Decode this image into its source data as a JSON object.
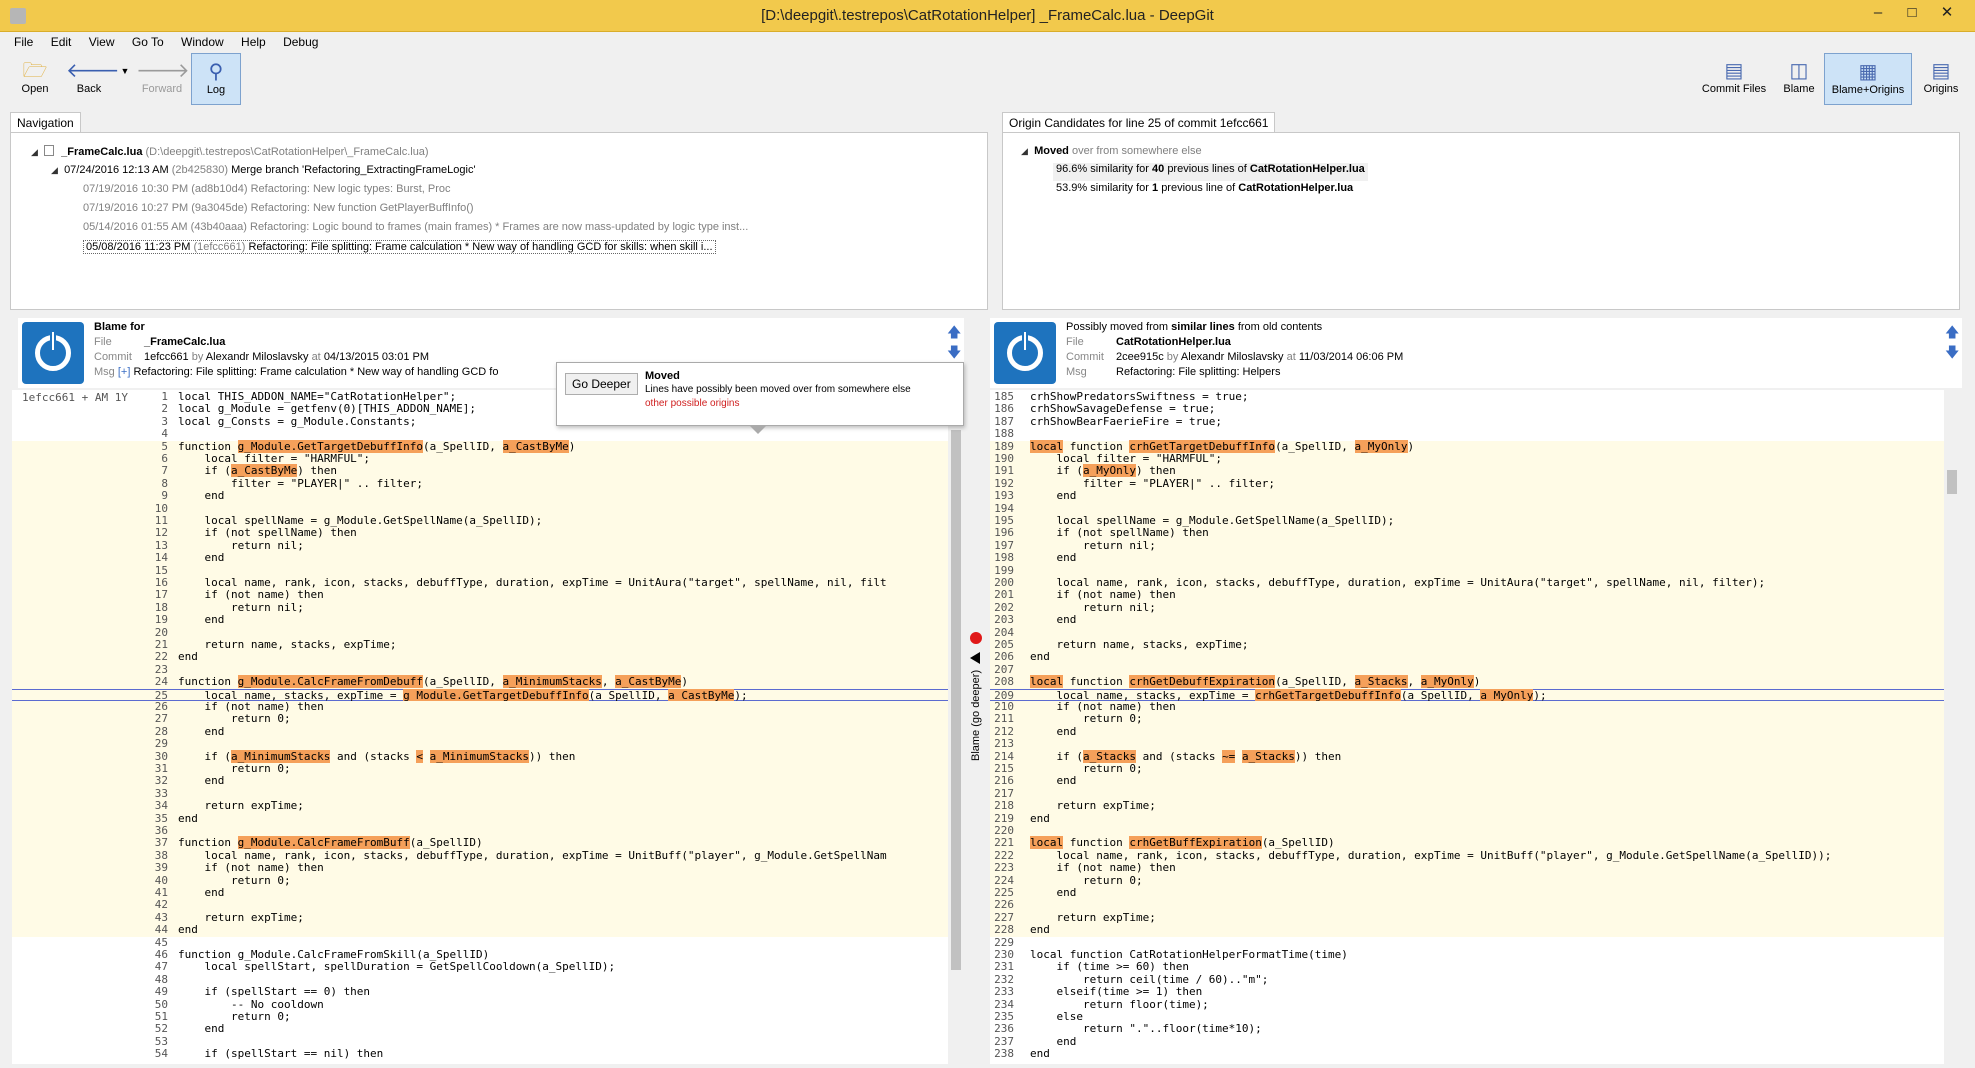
{
  "window": {
    "title": "[D:\\deepgit\\.testrepos\\CatRotationHelper] _FrameCalc.lua - DeepGit",
    "minimize": "–",
    "maximize": "□",
    "close": "✕"
  },
  "menu": [
    "File",
    "Edit",
    "View",
    "Go To",
    "Window",
    "Help",
    "Debug"
  ],
  "toolbar": {
    "open": "Open",
    "back": "Back",
    "forward": "Forward",
    "log": "Log",
    "commit_files": "Commit Files",
    "blame": "Blame",
    "blame_origins": "Blame+Origins",
    "origins": "Origins"
  },
  "navigation": {
    "tab": "Navigation",
    "root_file": "_FrameCalc.lua",
    "root_path": "(D:\\deepgit\\.testrepos\\CatRotationHelper\\_FrameCalc.lua)",
    "rows": [
      {
        "date": "07/24/2016 12:13 AM",
        "hash": "(2b425830)",
        "msg": "Merge branch 'Refactoring_ExtractingFrameLogic'"
      },
      {
        "date": "07/19/2016 10:30 PM",
        "hash": "(ad8b10d4)",
        "msg": "Refactoring: New logic types: Burst, Proc"
      },
      {
        "date": "07/19/2016 10:27 PM",
        "hash": "(9a3045de)",
        "msg": "Refactoring: New function GetPlayerBuffInfo()"
      },
      {
        "date": "05/14/2016 01:55 AM",
        "hash": "(43b40aaa)",
        "msg": "Refactoring: Logic bound to frames (main frames) * Frames are now mass-updated by logic type inst..."
      },
      {
        "date": "05/08/2016 11:23 PM",
        "hash": "(1efcc661)",
        "msg": "Refactoring: File splitting: Frame calculation * New way of handling GCD for skills: when skill i..."
      }
    ]
  },
  "origins_panel": {
    "tab": "Origin Candidates for line 25 of commit 1efcc661",
    "moved_label": "Moved",
    "moved_rest": "over from somewhere else",
    "candidates": [
      {
        "pct": "96.6%",
        "text_a": "similarity for",
        "count": "40",
        "text_b": "previous lines of",
        "file": "CatRotationHelper.lua"
      },
      {
        "pct": "53.9%",
        "text_a": "similarity for",
        "count": "1",
        "text_b": "previous line of",
        "file": "CatRotationHelper.lua"
      }
    ]
  },
  "left_header": {
    "title": "Blame for",
    "file_key": "File",
    "file": "_FrameCalc.lua",
    "commit_key": "Commit",
    "commit_hash": "1efcc661",
    "commit_by": "by",
    "author": "Alexandr Miloslavsky",
    "commit_at": "at",
    "date": "04/13/2015 03:01 PM",
    "msg_key": "Msg",
    "msg_plus": "[+]",
    "msg": "Refactoring: File splitting: Frame calculation * New way of handling GCD fo"
  },
  "right_header": {
    "title_a": "Possibly moved from",
    "title_b": "similar lines",
    "title_c": "from old contents",
    "file_key": "File",
    "file": "CatRotationHelper.lua",
    "commit_key": "Commit",
    "commit_hash": "2cee915c",
    "commit_by": "by",
    "author": "Alexandr Miloslavsky",
    "commit_at": "at",
    "date": "11/03/2014 06:06 PM",
    "msg_key": "Msg",
    "msg": "Refactoring: File splitting: Helpers"
  },
  "popup": {
    "button": "Go Deeper",
    "title": "Moved",
    "text": "Lines have possibly been moved over from somewhere else",
    "link": "other possible origins"
  },
  "splitter_label": "Blame (go deeper)",
  "left_gutter": "1efcc661  +  AM  1Y",
  "left_code": [
    {
      "n": "1",
      "t": "local THIS_ADDON_NAME=\"CatRotationHelper\";"
    },
    {
      "n": "2",
      "t": "local g_Module = getfenv(0)[THIS_ADDON_NAME];"
    },
    {
      "n": "3",
      "t": "local g_Consts = g_Module.Constants;"
    },
    {
      "n": "4",
      "t": ""
    },
    {
      "n": "5",
      "t": "function g_Module.GetTargetDebuffInfo(a_SpellID, a_CastByMe)"
    },
    {
      "n": "6",
      "t": "    local filter = \"HARMFUL\";"
    },
    {
      "n": "7",
      "t": "    if (a_CastByMe) then"
    },
    {
      "n": "8",
      "t": "        filter = \"PLAYER|\" .. filter;"
    },
    {
      "n": "9",
      "t": "    end"
    },
    {
      "n": "10",
      "t": ""
    },
    {
      "n": "11",
      "t": "    local spellName = g_Module.GetSpellName(a_SpellID);"
    },
    {
      "n": "12",
      "t": "    if (not spellName) then"
    },
    {
      "n": "13",
      "t": "        return nil;"
    },
    {
      "n": "14",
      "t": "    end"
    },
    {
      "n": "15",
      "t": ""
    },
    {
      "n": "16",
      "t": "    local name, rank, icon, stacks, debuffType, duration, expTime = UnitAura(\"target\", spellName, nil, filt"
    },
    {
      "n": "17",
      "t": "    if (not name) then"
    },
    {
      "n": "18",
      "t": "        return nil;"
    },
    {
      "n": "19",
      "t": "    end"
    },
    {
      "n": "20",
      "t": ""
    },
    {
      "n": "21",
      "t": "    return name, stacks, expTime;"
    },
    {
      "n": "22",
      "t": "end"
    },
    {
      "n": "23",
      "t": ""
    },
    {
      "n": "24",
      "t": "function g_Module.CalcFrameFromDebuff(a_SpellID, a_MinimumStacks, a_CastByMe)"
    },
    {
      "n": "25",
      "t": "    local name, stacks, expTime = g_Module.GetTargetDebuffInfo(a_SpellID, a_CastByMe);"
    },
    {
      "n": "26",
      "t": "    if (not name) then"
    },
    {
      "n": "27",
      "t": "        return 0;"
    },
    {
      "n": "28",
      "t": "    end"
    },
    {
      "n": "29",
      "t": ""
    },
    {
      "n": "30",
      "t": "    if (a_MinimumStacks and (stacks < a_MinimumStacks)) then"
    },
    {
      "n": "31",
      "t": "        return 0;"
    },
    {
      "n": "32",
      "t": "    end"
    },
    {
      "n": "33",
      "t": ""
    },
    {
      "n": "34",
      "t": "    return expTime;"
    },
    {
      "n": "35",
      "t": "end"
    },
    {
      "n": "36",
      "t": ""
    },
    {
      "n": "37",
      "t": "function g_Module.CalcFrameFromBuff(a_SpellID)"
    },
    {
      "n": "38",
      "t": "    local name, rank, icon, stacks, debuffType, duration, expTime = UnitBuff(\"player\", g_Module.GetSpellNam"
    },
    {
      "n": "39",
      "t": "    if (not name) then"
    },
    {
      "n": "40",
      "t": "        return 0;"
    },
    {
      "n": "41",
      "t": "    end"
    },
    {
      "n": "42",
      "t": ""
    },
    {
      "n": "43",
      "t": "    return expTime;"
    },
    {
      "n": "44",
      "t": "end"
    },
    {
      "n": "45",
      "t": ""
    },
    {
      "n": "46",
      "t": "function g_Module.CalcFrameFromSkill(a_SpellID)"
    },
    {
      "n": "47",
      "t": "    local spellStart, spellDuration = GetSpellCooldown(a_SpellID);"
    },
    {
      "n": "48",
      "t": ""
    },
    {
      "n": "49",
      "t": "    if (spellStart == 0) then"
    },
    {
      "n": "50",
      "t": "        -- No cooldown"
    },
    {
      "n": "51",
      "t": "        return 0;"
    },
    {
      "n": "52",
      "t": "    end"
    },
    {
      "n": "53",
      "t": ""
    },
    {
      "n": "54",
      "t": "    if (spellStart == nil) then"
    }
  ],
  "right_code": [
    {
      "n": "185",
      "t": "crhShowPredatorsSwiftness = true;"
    },
    {
      "n": "186",
      "t": "crhShowSavageDefense = true;"
    },
    {
      "n": "187",
      "t": "crhShowBearFaerieFire = true;"
    },
    {
      "n": "188",
      "t": ""
    },
    {
      "n": "189",
      "t": "local function crhGetTargetDebuffInfo(a_SpellID, a_MyOnly)"
    },
    {
      "n": "190",
      "t": "    local filter = \"HARMFUL\";"
    },
    {
      "n": "191",
      "t": "    if (a_MyOnly) then"
    },
    {
      "n": "192",
      "t": "        filter = \"PLAYER|\" .. filter;"
    },
    {
      "n": "193",
      "t": "    end"
    },
    {
      "n": "194",
      "t": ""
    },
    {
      "n": "195",
      "t": "    local spellName = g_Module.GetSpellName(a_SpellID);"
    },
    {
      "n": "196",
      "t": "    if (not spellName) then"
    },
    {
      "n": "197",
      "t": "        return nil;"
    },
    {
      "n": "198",
      "t": "    end"
    },
    {
      "n": "199",
      "t": ""
    },
    {
      "n": "200",
      "t": "    local name, rank, icon, stacks, debuffType, duration, expTime = UnitAura(\"target\", spellName, nil, filter);"
    },
    {
      "n": "201",
      "t": "    if (not name) then"
    },
    {
      "n": "202",
      "t": "        return nil;"
    },
    {
      "n": "203",
      "t": "    end"
    },
    {
      "n": "204",
      "t": ""
    },
    {
      "n": "205",
      "t": "    return name, stacks, expTime;"
    },
    {
      "n": "206",
      "t": "end"
    },
    {
      "n": "207",
      "t": ""
    },
    {
      "n": "208",
      "t": "local function crhGetDebuffExpiration(a_SpellID, a_Stacks, a_MyOnly)"
    },
    {
      "n": "209",
      "t": "    local name, stacks, expTime = crhGetTargetDebuffInfo(a_SpellID, a_MyOnly);"
    },
    {
      "n": "210",
      "t": "    if (not name) then"
    },
    {
      "n": "211",
      "t": "        return 0;"
    },
    {
      "n": "212",
      "t": "    end"
    },
    {
      "n": "213",
      "t": ""
    },
    {
      "n": "214",
      "t": "    if (a_Stacks and (stacks ~= a_Stacks)) then"
    },
    {
      "n": "215",
      "t": "        return 0;"
    },
    {
      "n": "216",
      "t": "    end"
    },
    {
      "n": "217",
      "t": ""
    },
    {
      "n": "218",
      "t": "    return expTime;"
    },
    {
      "n": "219",
      "t": "end"
    },
    {
      "n": "220",
      "t": ""
    },
    {
      "n": "221",
      "t": "local function crhGetBuffExpiration(a_SpellID)"
    },
    {
      "n": "222",
      "t": "    local name, rank, icon, stacks, debuffType, duration, expTime = UnitBuff(\"player\", g_Module.GetSpellName(a_SpellID));"
    },
    {
      "n": "223",
      "t": "    if (not name) then"
    },
    {
      "n": "224",
      "t": "        return 0;"
    },
    {
      "n": "225",
      "t": "    end"
    },
    {
      "n": "226",
      "t": ""
    },
    {
      "n": "227",
      "t": "    return expTime;"
    },
    {
      "n": "228",
      "t": "end"
    },
    {
      "n": "229",
      "t": ""
    },
    {
      "n": "230",
      "t": "local function CatRotationHelperFormatTime(time)"
    },
    {
      "n": "231",
      "t": "    if (time >= 60) then"
    },
    {
      "n": "232",
      "t": "        return ceil(time / 60)..\"m\";"
    },
    {
      "n": "233",
      "t": "    elseif(time >= 1) then"
    },
    {
      "n": "234",
      "t": "        return floor(time);"
    },
    {
      "n": "235",
      "t": "    else"
    },
    {
      "n": "236",
      "t": "        return \".\"..floor(time*10);"
    },
    {
      "n": "237",
      "t": "    end"
    },
    {
      "n": "238",
      "t": "end"
    }
  ],
  "left_highlights": {
    "5": [
      "g_Module.GetTargetDebuffInfo",
      "a_CastByMe"
    ],
    "7": [
      "a_CastByMe"
    ],
    "24": [
      "g_Module.CalcFrameFromDebuff",
      "a_MinimumStacks",
      "a_CastByMe"
    ],
    "25": [
      "g_Module.GetTargetDebuffInfo",
      "a_CastByMe"
    ],
    "30": [
      "a_MinimumStacks",
      "<",
      "a_MinimumStacks"
    ],
    "37": [
      "g_Module.CalcFrameFromBuff"
    ]
  },
  "right_highlights": {
    "189": [
      "local",
      "crhGetTargetDebuffInfo",
      "a_MyOnly"
    ],
    "191": [
      "a_MyOnly"
    ],
    "208": [
      "local",
      "crhGetDebuffExpiration",
      "a_Stacks",
      "a_MyOnly"
    ],
    "209": [
      "crhGetTargetDebuffInfo",
      "a_MyOnly"
    ],
    "214": [
      "a_Stacks",
      "~=",
      "a_Stacks"
    ],
    "221": [
      "local",
      "crhGetBuffExpiration"
    ]
  },
  "current_line_left": "25",
  "current_line_right": "209",
  "colors": {
    "accent_title": "#f2c94c",
    "highlight": "#f5a05a",
    "moved_background": "#fffbe6",
    "current_line_border": "#5b6bd0",
    "power_icon": "#1e73be"
  }
}
